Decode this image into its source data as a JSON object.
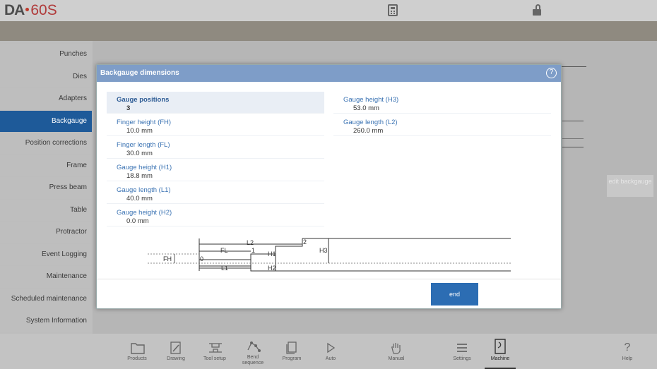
{
  "app": {
    "logo_brand": "DA",
    "logo_model": "60S"
  },
  "sidebar": {
    "items": [
      {
        "label": "Punches"
      },
      {
        "label": "Dies"
      },
      {
        "label": "Adapters"
      },
      {
        "label": "Backgauge",
        "active": true
      },
      {
        "label": "Position corrections"
      },
      {
        "label": "Frame"
      },
      {
        "label": "Press beam"
      },
      {
        "label": "Table"
      },
      {
        "label": "Protractor"
      },
      {
        "label": "Event Logging"
      },
      {
        "label": "Maintenance"
      },
      {
        "label": "Scheduled maintenance"
      },
      {
        "label": "System Information"
      }
    ]
  },
  "background": {
    "edit_button_label": "edit backgauge"
  },
  "dialog": {
    "title": "Backgauge dimensions",
    "help_symbol": "?",
    "left_fields": [
      {
        "label": "Gauge positions",
        "value": "3"
      },
      {
        "label": "Finger height (FH)",
        "value": "10.0 mm"
      },
      {
        "label": "Finger length (FL)",
        "value": "30.0 mm"
      },
      {
        "label": "Gauge height (H1)",
        "value": "18.8 mm"
      },
      {
        "label": "Gauge length (L1)",
        "value": "40.0 mm"
      },
      {
        "label": "Gauge height (H2)",
        "value": "0.0 mm"
      }
    ],
    "right_fields": [
      {
        "label": "Gauge height (H3)",
        "value": "53.0 mm"
      },
      {
        "label": "Gauge length (L2)",
        "value": "260.0 mm"
      }
    ],
    "diagram": {
      "labels": {
        "l2": "L2",
        "fl": "FL",
        "one": "1",
        "two": "2",
        "h1": "H1",
        "h3": "H3",
        "fh": "FH",
        "zero": "0",
        "l1": "L1",
        "h2": "H2"
      }
    },
    "end_label": "end"
  },
  "bottom_tabs": [
    {
      "label": "Products",
      "icon": "folder-icon"
    },
    {
      "label": "Drawing",
      "icon": "pencil-icon"
    },
    {
      "label": "Tool setup",
      "icon": "tool-setup-icon"
    },
    {
      "label": "Bend sequence",
      "icon": "bend-sequence-icon"
    },
    {
      "label": "Program",
      "icon": "program-icon"
    },
    {
      "label": "Auto",
      "icon": "play-icon"
    },
    {
      "label": "Manual",
      "icon": "hand-icon"
    },
    {
      "label": "Settings",
      "icon": "list-icon"
    },
    {
      "label": "Machine",
      "icon": "machine-icon",
      "active": true
    },
    {
      "label": "Help",
      "icon": "help-icon"
    }
  ]
}
